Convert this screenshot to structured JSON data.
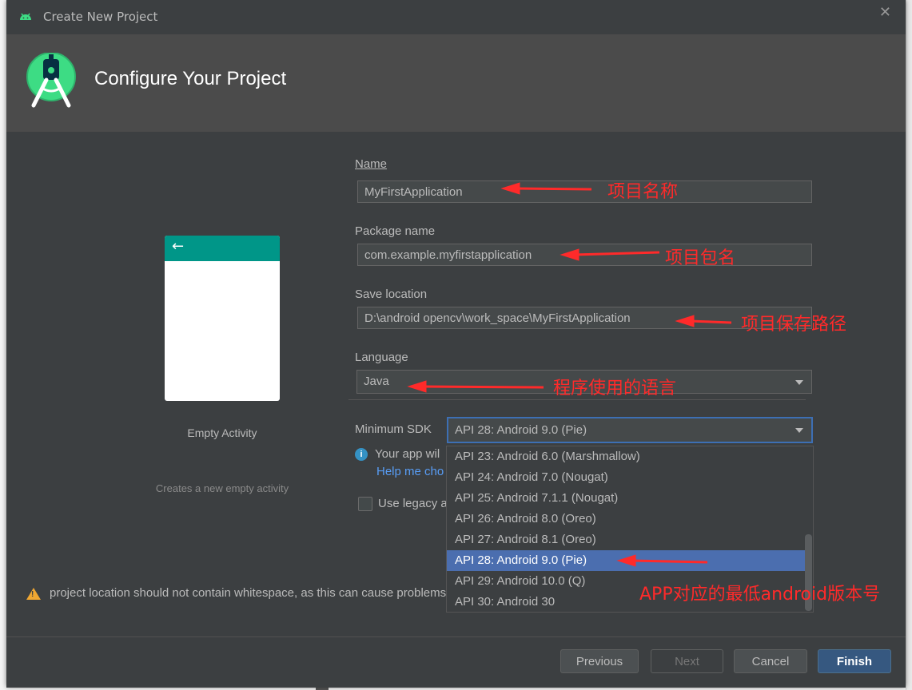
{
  "window": {
    "title": "Create New Project",
    "close_glyph": "✕"
  },
  "header": {
    "title": "Configure Your Project",
    "logo_icon": "android-studio-logo-icon"
  },
  "preview": {
    "back_glyph": "←",
    "label": "Empty Activity",
    "description": "Creates a new empty activity"
  },
  "form": {
    "name_label": "Name",
    "name_value": "MyFirstApplication",
    "package_label": "Package name",
    "package_value": "com.example.myfirstapplication",
    "location_label": "Save location",
    "location_value": "D:\\android opencv\\work_space\\MyFirstApplication",
    "language_label": "Language",
    "language_value": "Java",
    "sdk_label": "Minimum SDK",
    "sdk_value": "API 28: Android 9.0 (Pie)",
    "info_glyph": "i",
    "info_text": "Your app wil",
    "help_link": "Help me cho",
    "legacy_label": "Use legacy a"
  },
  "sdk_options": [
    "API 23: Android 6.0 (Marshmallow)",
    "API 24: Android 7.0 (Nougat)",
    "API 25: Android 7.1.1 (Nougat)",
    "API 26: Android 8.0 (Oreo)",
    "API 27: Android 8.1 (Oreo)",
    "API 28: Android 9.0 (Pie)",
    "API 29: Android 10.0 (Q)",
    "API 30: Android 30"
  ],
  "sdk_selected_index": 5,
  "warning": {
    "text": "project location should not contain whitespace, as this can cause problems with the NDK tools."
  },
  "buttons": {
    "previous": "Previous",
    "next": "Next",
    "cancel": "Cancel",
    "finish": "Finish"
  },
  "annotations": {
    "name": "项目名称",
    "package": "项目包名",
    "location": "项目保存路径",
    "language": "程序使用的语言",
    "sdk": "APP对应的最低android版本号"
  },
  "colors": {
    "dialog_bg": "#3c3f41",
    "header_bg": "#4b4b4b",
    "selection": "#4b6eaf",
    "annotation": "#ff2a2a",
    "preview_toolbar": "#009688",
    "android_green": "#3ddc84"
  }
}
